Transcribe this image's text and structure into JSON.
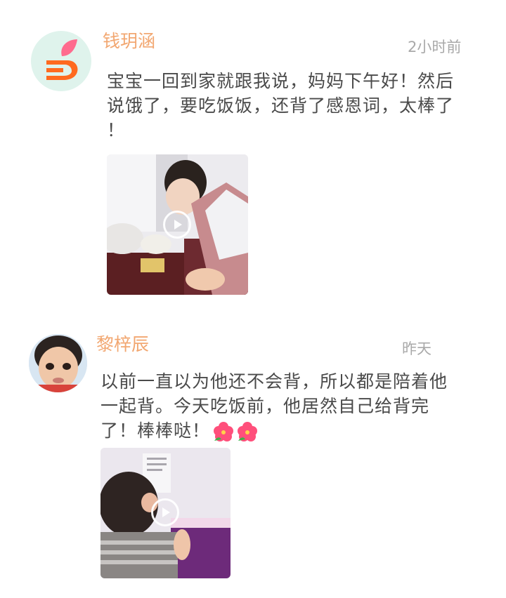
{
  "posts": [
    {
      "author": "钱玥涵",
      "time": "2小时前",
      "text_lines": [
        "宝宝一回到家就跟我说，妈妈下午好！然后",
        "说饿了，要吃饭饭，还背了感恩词，太棒了",
        "！"
      ],
      "avatar_icon": "logo-icon",
      "media": {
        "type": "video",
        "icon": "play-icon"
      }
    },
    {
      "author": "黎梓辰",
      "time": "昨天",
      "text_lines": [
        "以前一直以为他还不会背，所以都是陪着他",
        "一起背。今天吃饭前，他居然自己给背完",
        "了！棒棒哒！"
      ],
      "emoji": [
        "hibiscus-flower-icon",
        "hibiscus-flower-icon"
      ],
      "avatar_icon": "child-photo",
      "media": {
        "type": "video",
        "icon": "play-icon"
      }
    }
  ],
  "colors": {
    "name": "#f2a771",
    "time": "#a9a9a9",
    "text": "#4a4a4a",
    "avatar_bg": "#dff3ec",
    "logo_orange": "#ff6a1f",
    "logo_pink": "#ff6b8e"
  }
}
